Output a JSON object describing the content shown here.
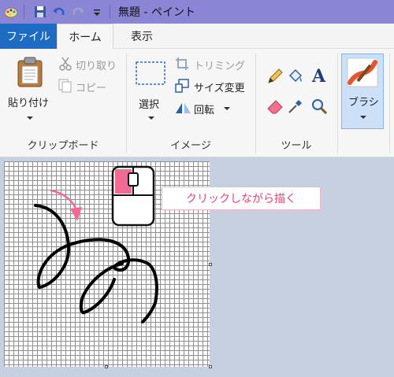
{
  "window": {
    "title": "無題 - ペイント"
  },
  "tabs": {
    "file": "ファイル",
    "home": "ホーム",
    "view": "表示"
  },
  "clipboard": {
    "paste": "貼り付け",
    "cut": "切り取り",
    "copy": "コピー",
    "group": "クリップボード"
  },
  "image": {
    "select": "選択",
    "crop": "トリミング",
    "resize": "サイズ変更",
    "rotate": "回転",
    "group": "イメージ"
  },
  "tools": {
    "group": "ツール"
  },
  "brushes": {
    "label": "ブラシ"
  },
  "annotation": {
    "text": "クリックしながら描く",
    "color": "#e8457a"
  },
  "colors": {
    "titlebar": "#8b85d6",
    "file_tab": "#1e6bc4",
    "workspace": "#c6d0e0",
    "accent_pink": "#e8457a"
  }
}
